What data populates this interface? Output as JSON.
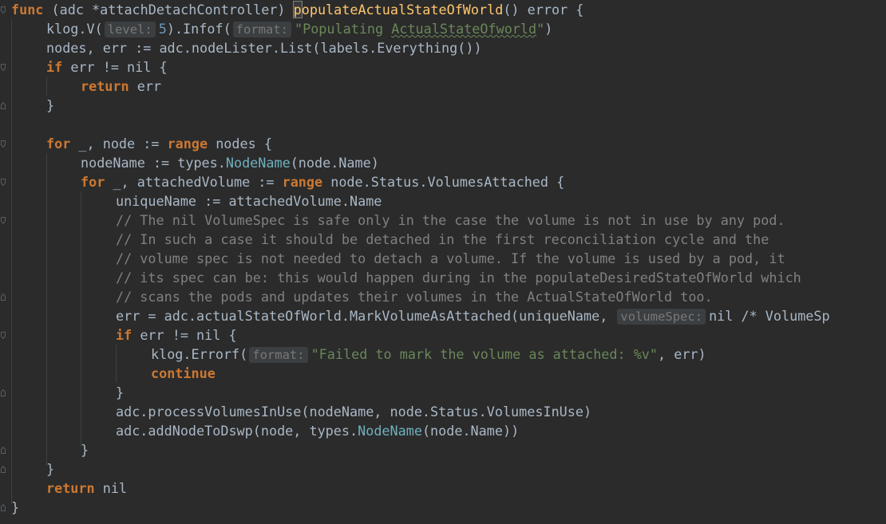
{
  "editor": {
    "theme": "darcula",
    "colors": {
      "background": "#2b2b2b",
      "keyword": "#cc7832",
      "function": "#ffc66d",
      "type": "#6fafbd",
      "string": "#6a8759",
      "number": "#6897bb",
      "comment": "#808080",
      "text": "#a9b7c6"
    },
    "code": {
      "l1": {
        "kw_func": "func",
        "recv": " (adc *attachDetachController) ",
        "fname_first": "p",
        "fname_rest": "opulateActualStateOfWorld",
        "sig_tail": "() ",
        "ret": "error {"
      },
      "l2": {
        "pre": "klog.V(",
        "hint": "level:",
        "num": "5",
        "mid": ").Infof(",
        "hint2": "format:",
        "str_pre": "\"Populating ",
        "str_sq": "ActualStateOfworld",
        "str_post": "\"",
        "post": ")"
      },
      "l3": {
        "text": "nodes, err := adc.nodeLister.List(labels.Everything())"
      },
      "l4": {
        "kw": "if",
        "text": " err != nil {"
      },
      "l5": {
        "kw": "return",
        "text": " err"
      },
      "l6": {
        "text": "}"
      },
      "l7": {
        "kw_for": "for",
        "mid": " _, node := ",
        "kw_range": "range",
        "post": " nodes {"
      },
      "l8": {
        "pre": "nodeName := types.",
        "type": "NodeName",
        "post": "(node.Name)"
      },
      "l9": {
        "kw_for": "for",
        "mid": " _, attachedVolume := ",
        "kw_range": "range",
        "post": " node.Status.VolumesAttached {"
      },
      "l10": {
        "text": "uniqueName := attachedVolume.Name"
      },
      "l11": {
        "text": "// The nil VolumeSpec is safe only in the case the volume is not in use by any pod."
      },
      "l12": {
        "text": "// In such a case it should be detached in the first reconciliation cycle and the"
      },
      "l13": {
        "text": "// volume spec is not needed to detach a volume. If the volume is used by a pod, it"
      },
      "l14": {
        "text": "// its spec can be: this would happen during in the populateDesiredStateOfWorld which"
      },
      "l15": {
        "text": "// scans the pods and updates their volumes in the ActualStateOfWorld too."
      },
      "l16": {
        "pre": "err = adc.actualStateOfWorld.MarkVolumeAsAttached(uniqueName, ",
        "hint": "volumeSpec:",
        "post": "nil /* VolumeSp"
      },
      "l17": {
        "kw": "if",
        "text": " err != nil {"
      },
      "l18": {
        "pre": "klog.Errorf(",
        "hint": "format:",
        "str": "\"Failed to mark the volume as attached: %v\"",
        "post": ", err)"
      },
      "l19": {
        "kw": "continue"
      },
      "l20": {
        "text": "}"
      },
      "l21": {
        "text": "adc.processVolumesInUse(nodeName, node.Status.VolumesInUse)"
      },
      "l22": {
        "pre": "adc.addNodeToDswp(node, types.",
        "type": "NodeName",
        "post": "(node.Name))"
      },
      "l23": {
        "text": "}"
      },
      "l24": {
        "text": "}"
      },
      "l25": {
        "kw": "return",
        "text": " nil"
      },
      "l26": {
        "text": "}"
      }
    }
  }
}
